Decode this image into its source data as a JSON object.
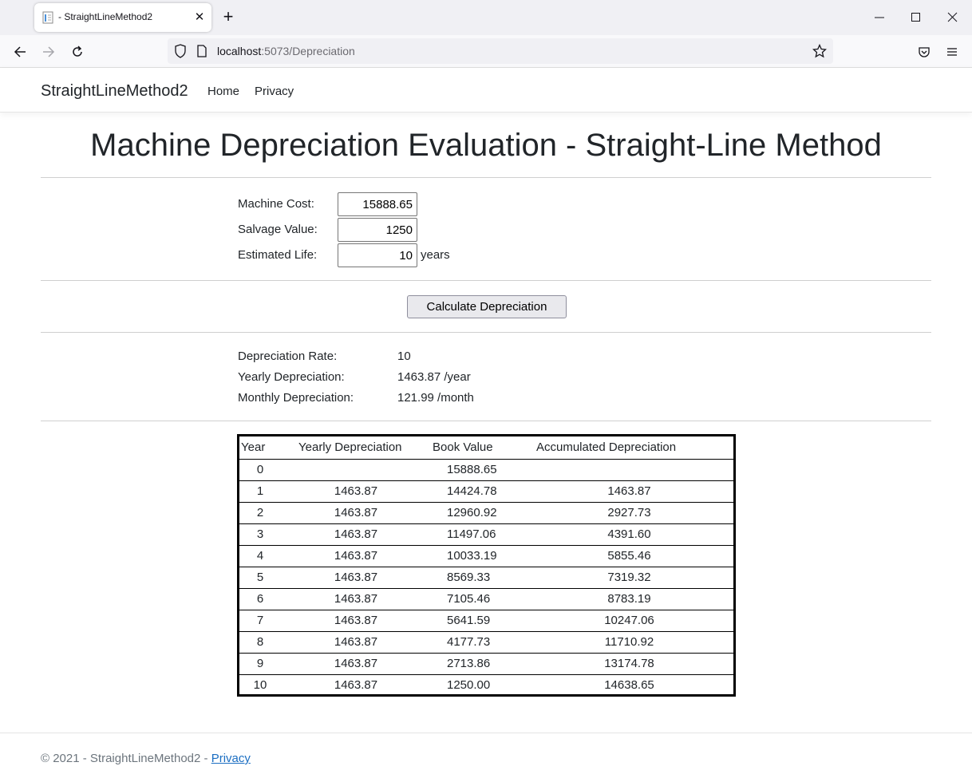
{
  "browser": {
    "tab_title": "- StraightLineMethod2",
    "url_host": "localhost",
    "url_path": ":5073/Depreciation"
  },
  "site": {
    "brand": "StraightLineMethod2",
    "nav": [
      "Home",
      "Privacy"
    ]
  },
  "page": {
    "title": "Machine Depreciation Evaluation - Straight-Line Method"
  },
  "form": {
    "machine_cost_label": "Machine Cost:",
    "machine_cost_value": "15888.65",
    "salvage_value_label": "Salvage Value:",
    "salvage_value_value": "1250",
    "estimated_life_label": "Estimated Life:",
    "estimated_life_value": "10",
    "estimated_life_unit": "years",
    "calculate_label": "Calculate Depreciation"
  },
  "results": {
    "rate_label": "Depreciation Rate:",
    "rate_value": "10",
    "yearly_label": "Yearly Depreciation:",
    "yearly_value": "1463.87 /year",
    "monthly_label": "Monthly Depreciation:",
    "monthly_value": "121.99 /month"
  },
  "table": {
    "headers": [
      "Year",
      "Yearly Depreciation",
      "Book Value",
      "Accumulated Depreciation"
    ],
    "rows": [
      {
        "year": "0",
        "yearly": "",
        "book": "15888.65",
        "accum": ""
      },
      {
        "year": "1",
        "yearly": "1463.87",
        "book": "14424.78",
        "accum": "1463.87"
      },
      {
        "year": "2",
        "yearly": "1463.87",
        "book": "12960.92",
        "accum": "2927.73"
      },
      {
        "year": "3",
        "yearly": "1463.87",
        "book": "11497.06",
        "accum": "4391.60"
      },
      {
        "year": "4",
        "yearly": "1463.87",
        "book": "10033.19",
        "accum": "5855.46"
      },
      {
        "year": "5",
        "yearly": "1463.87",
        "book": "8569.33",
        "accum": "7319.32"
      },
      {
        "year": "6",
        "yearly": "1463.87",
        "book": "7105.46",
        "accum": "8783.19"
      },
      {
        "year": "7",
        "yearly": "1463.87",
        "book": "5641.59",
        "accum": "10247.06"
      },
      {
        "year": "8",
        "yearly": "1463.87",
        "book": "4177.73",
        "accum": "11710.92"
      },
      {
        "year": "9",
        "yearly": "1463.87",
        "book": "2713.86",
        "accum": "13174.78"
      },
      {
        "year": "10",
        "yearly": "1463.87",
        "book": "1250.00",
        "accum": "14638.65"
      }
    ]
  },
  "footer": {
    "text": "© 2021 - StraightLineMethod2 - ",
    "link": "Privacy"
  }
}
